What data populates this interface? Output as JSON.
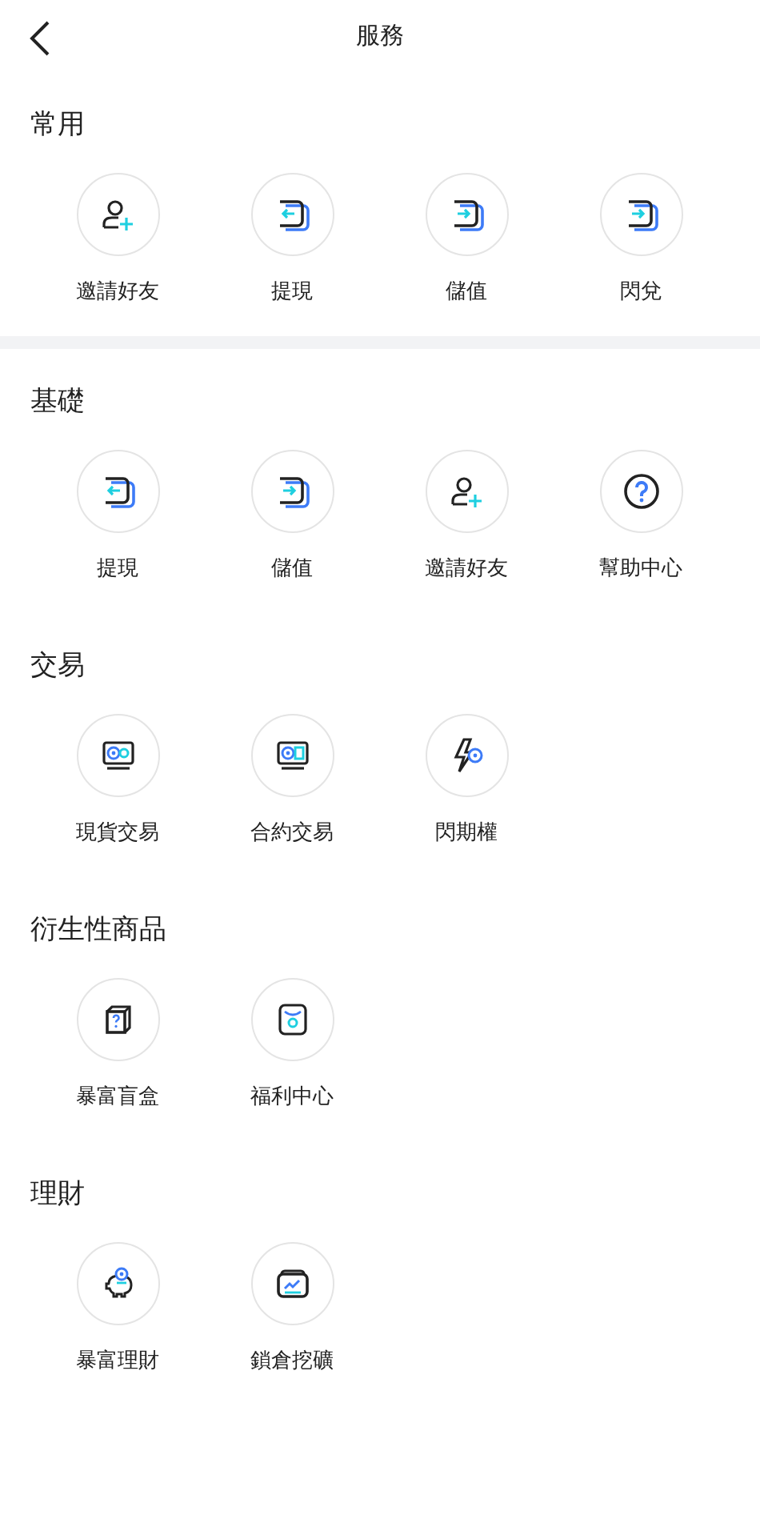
{
  "header": {
    "title": "服務"
  },
  "sections": [
    {
      "title": "常用",
      "items": [
        {
          "label": "邀請好友",
          "kind": "invite"
        },
        {
          "label": "提現",
          "kind": "withdraw"
        },
        {
          "label": "儲值",
          "kind": "deposit"
        },
        {
          "label": "閃兌",
          "kind": "deposit"
        }
      ]
    },
    {
      "title": "基礎",
      "items": [
        {
          "label": "提現",
          "kind": "withdraw"
        },
        {
          "label": "儲值",
          "kind": "deposit"
        },
        {
          "label": "邀請好友",
          "kind": "invite"
        },
        {
          "label": "幫助中心",
          "kind": "help"
        }
      ]
    },
    {
      "title": "交易",
      "items": [
        {
          "label": "現貨交易",
          "kind": "spot"
        },
        {
          "label": "合約交易",
          "kind": "contract"
        },
        {
          "label": "閃期權",
          "kind": "flash"
        }
      ]
    },
    {
      "title": "衍生性商品",
      "items": [
        {
          "label": "暴富盲盒",
          "kind": "box"
        },
        {
          "label": "福利中心",
          "kind": "bag"
        }
      ]
    },
    {
      "title": "理財",
      "items": [
        {
          "label": "暴富理財",
          "kind": "piggy"
        },
        {
          "label": "鎖倉挖礦",
          "kind": "chart"
        }
      ]
    }
  ]
}
